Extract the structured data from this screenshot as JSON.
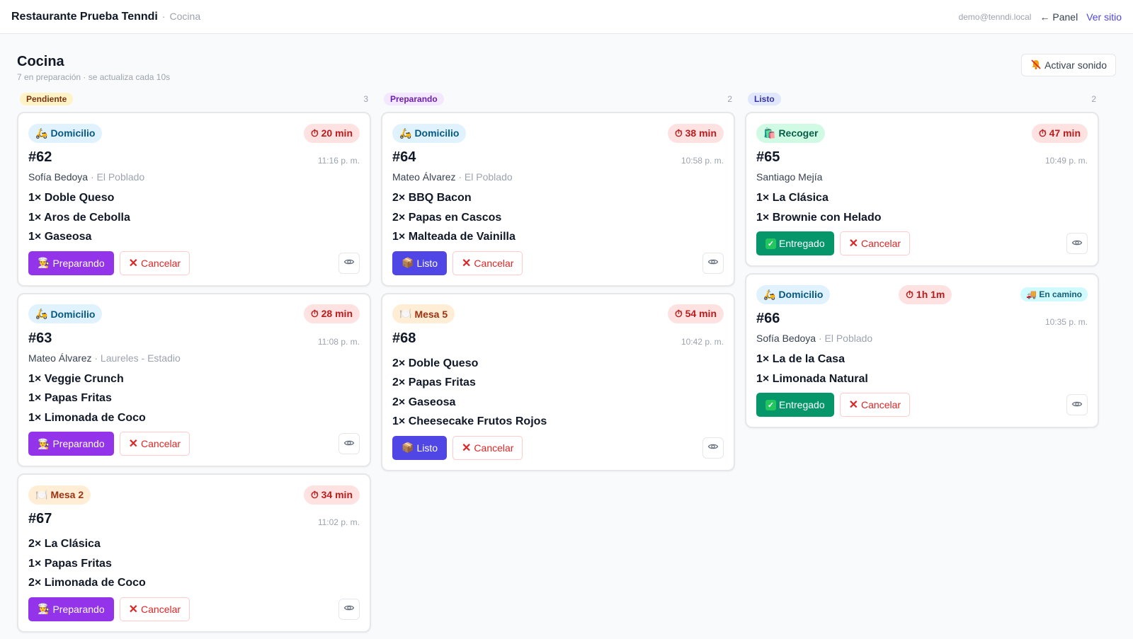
{
  "header": {
    "restaurant": "Restaurante Prueba Tenndi",
    "separator": "·",
    "section": "Cocina",
    "email": "demo@tenndi.local",
    "panel_link": "← Panel",
    "site_link": "Ver sitio"
  },
  "page": {
    "title": "Cocina",
    "subtitle": "7 en preparación · se actualiza cada 10s",
    "sound_button": "Activar sonido"
  },
  "columns": {
    "pendiente": {
      "label": "Pendiente",
      "count": "3",
      "cards": [
        {
          "type": "Domicilio",
          "timer": "⏱ 20 min",
          "number": "#62",
          "time": "11:16 p. m.",
          "customer": "Sofía Bedoya",
          "zone": "· El Poblado",
          "items": [
            "1× Doble Queso",
            "1× Aros de Cebolla",
            "1× Gaseosa"
          ],
          "primary": "Preparando",
          "cancel": "Cancelar"
        },
        {
          "type": "Domicilio",
          "timer": "⏱ 28 min",
          "number": "#63",
          "time": "11:08 p. m.",
          "customer": "Mateo Álvarez",
          "zone": "· Laureles - Estadio",
          "items": [
            "1× Veggie Crunch",
            "1× Papas Fritas",
            "1× Limonada de Coco"
          ],
          "primary": "Preparando",
          "cancel": "Cancelar"
        },
        {
          "type": "Mesa 2",
          "timer": "⏱ 34 min",
          "number": "#67",
          "time": "11:02 p. m.",
          "items": [
            "2× La Clásica",
            "1× Papas Fritas",
            "2× Limonada de Coco"
          ],
          "primary": "Preparando",
          "cancel": "Cancelar"
        }
      ]
    },
    "preparando": {
      "label": "Preparando",
      "count": "2",
      "cards": [
        {
          "type": "Domicilio",
          "timer": "⏱ 38 min",
          "number": "#64",
          "time": "10:58 p. m.",
          "customer": "Mateo Álvarez",
          "zone": "· El Poblado",
          "items": [
            "2× BBQ Bacon",
            "2× Papas en Cascos",
            "1× Malteada de Vainilla"
          ],
          "primary": "Listo",
          "cancel": "Cancelar"
        },
        {
          "type": "Mesa 5",
          "timer": "⏱ 54 min",
          "number": "#68",
          "time": "10:42 p. m.",
          "items": [
            "2× Doble Queso",
            "2× Papas Fritas",
            "2× Gaseosa",
            "1× Cheesecake Frutos Rojos"
          ],
          "primary": "Listo",
          "cancel": "Cancelar"
        }
      ]
    },
    "listo": {
      "label": "Listo",
      "count": "2",
      "cards": [
        {
          "type": "Recoger",
          "timer": "⏱ 47 min",
          "number": "#65",
          "time": "10:49 p. m.",
          "customer": "Santiago Mejía",
          "items": [
            "1× La Clásica",
            "1× Brownie con Helado"
          ],
          "primary": "Entregado",
          "cancel": "Cancelar"
        },
        {
          "type": "Domicilio",
          "timer": "⏱ 1h 1m",
          "status": "En camino",
          "number": "#66",
          "time": "10:35 p. m.",
          "customer": "Sofía Bedoya",
          "zone": "· El Poblado",
          "items": [
            "1× La de la Casa",
            "1× Limonada Natural"
          ],
          "primary": "Entregado",
          "cancel": "Cancelar"
        }
      ]
    }
  },
  "colors": {
    "preparando_btn": "#9333ea",
    "listo_btn": "#4f46e5",
    "entregado_btn": "#059669",
    "cancel": "#dc2626",
    "timer": "#b91c1c"
  },
  "icons": {
    "domicilio": "scooter-icon",
    "mesa": "plate-icon",
    "recoger": "bag-icon",
    "preparando": "cook-icon",
    "listo": "package-icon",
    "entregado": "check-icon",
    "cancel": "cross-icon",
    "view": "eye-icon",
    "sound": "bell-off-icon",
    "en_camino": "truck-icon"
  }
}
